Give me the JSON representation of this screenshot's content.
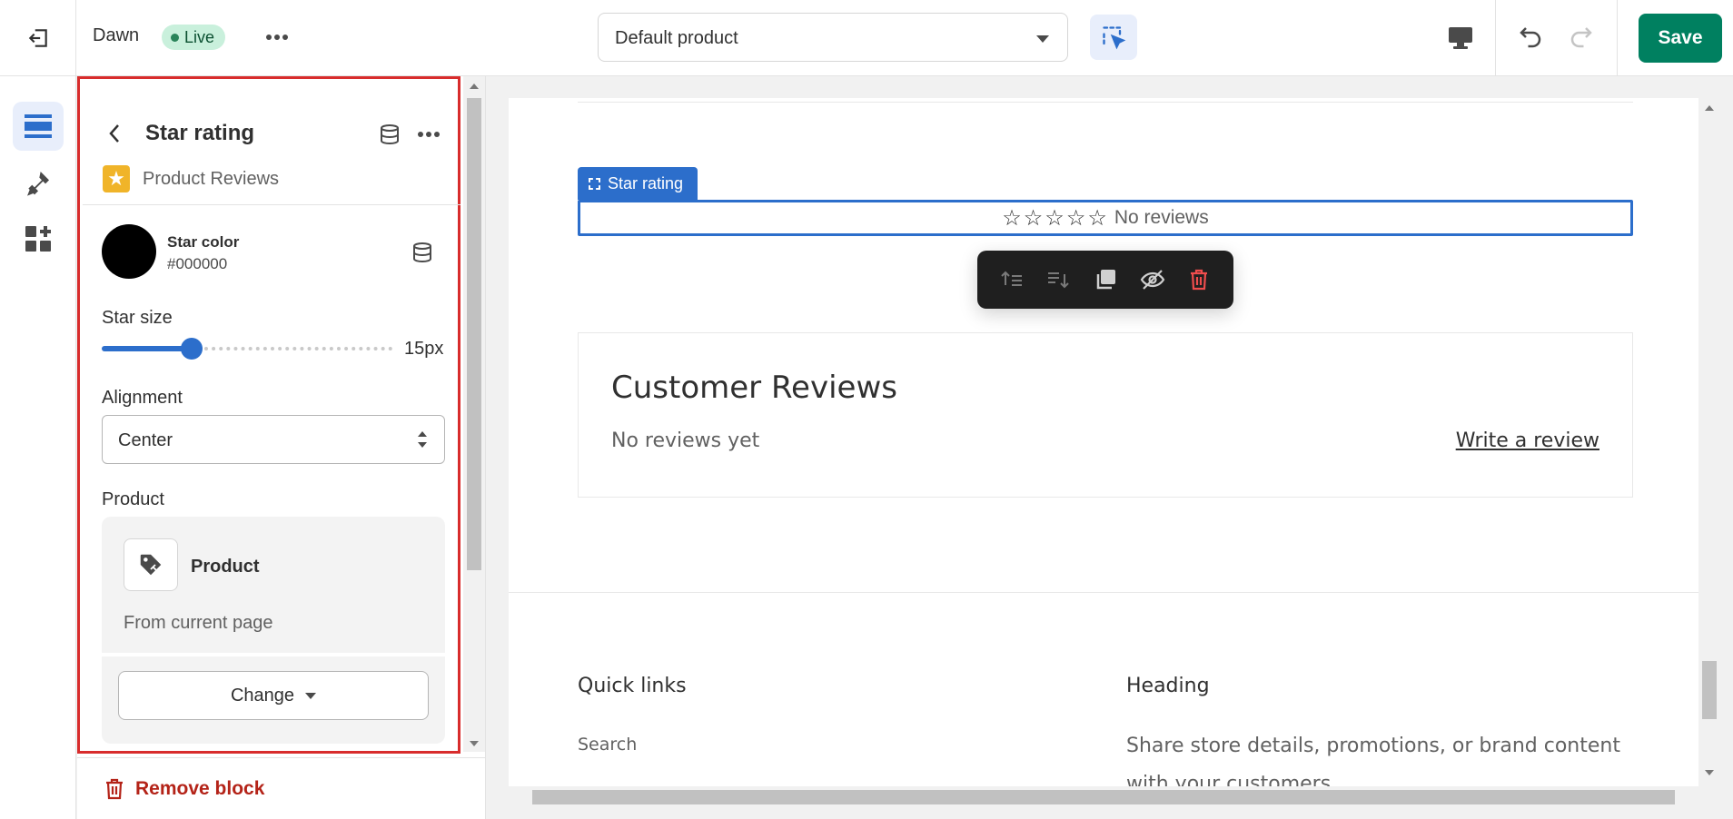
{
  "topbar": {
    "theme_name": "Dawn",
    "live_label": "Live",
    "template_value": "Default product",
    "save_label": "Save"
  },
  "rail": {
    "items": [
      {
        "icon": "sections-icon",
        "active": true
      },
      {
        "icon": "theme-settings-icon",
        "active": false
      },
      {
        "icon": "app-embeds-icon",
        "active": false
      }
    ]
  },
  "sidebar": {
    "title": "Star rating",
    "app_name": "Product Reviews",
    "star_color": {
      "label": "Star color",
      "value": "#000000",
      "swatch": "#000000"
    },
    "star_size": {
      "label": "Star size",
      "value_text": "15px",
      "fill_fraction": 0.31
    },
    "alignment": {
      "label": "Alignment",
      "value": "Center"
    },
    "product": {
      "label": "Product",
      "name": "Product",
      "source": "From current page",
      "change_label": "Change"
    },
    "remove_label": "Remove block"
  },
  "preview": {
    "block_tag": "Star rating",
    "stars": "☆☆☆☆☆",
    "no_reviews": "No reviews",
    "reviews_title": "Customer Reviews",
    "reviews_empty": "No reviews yet",
    "write_review": "Write a review",
    "footer": {
      "quick_links_heading": "Quick links",
      "quick_links": [
        "Search"
      ],
      "heading": "Heading",
      "text": "Share store details, promotions, or brand content with your customers."
    }
  },
  "colors": {
    "accent": "#2c6ecb",
    "save": "#008060",
    "highlight": "#d82c2c",
    "danger": "#b42318",
    "star_icon_bg": "#f0b429"
  }
}
